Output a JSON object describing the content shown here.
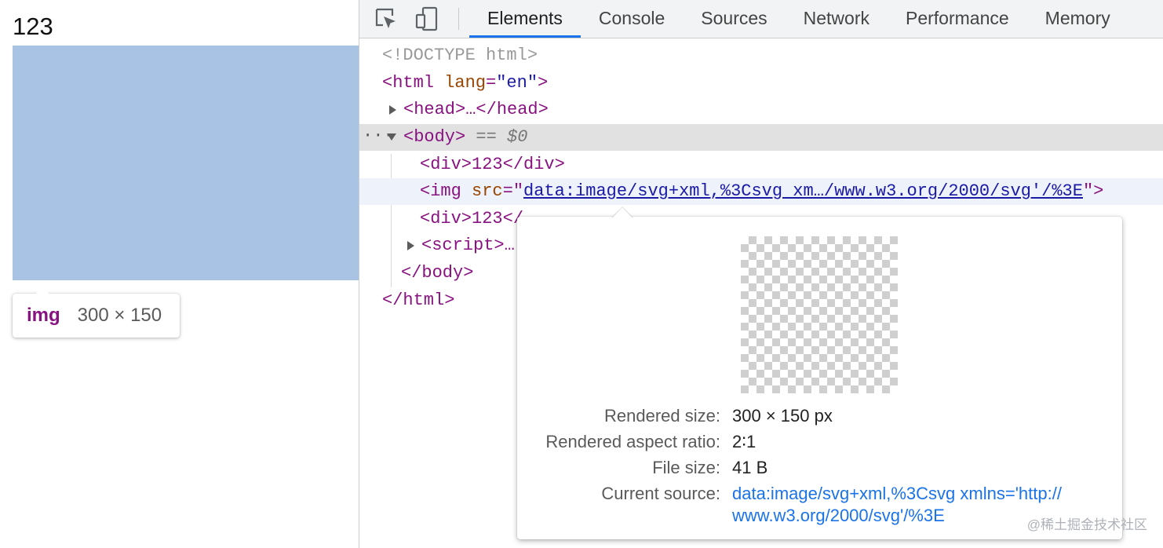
{
  "preview": {
    "page_text": "123",
    "tooltip_tag": "img",
    "tooltip_size": "300 × 150"
  },
  "devtools": {
    "tabs": [
      "Elements",
      "Console",
      "Sources",
      "Network",
      "Performance",
      "Memory"
    ],
    "active_tab": "Elements",
    "dom": {
      "doctype": "<!DOCTYPE html>",
      "html_open_tag": "<html",
      "html_attr_name": "lang",
      "html_attr_value": "\"en\"",
      "head": "<head>…</head>",
      "body_dots": "···",
      "body_tag": "<body>",
      "body_eq": "== $0",
      "div1": "<div>123</div>",
      "img_tag_open": "<img",
      "img_attr_name": "src",
      "img_src": "data:image/svg+xml,%3Csvg xm…/www.w3.org/2000/svg'/%3E",
      "img_tag_close": ">",
      "div2_visible": "<div>123</",
      "script_visible": "<script>…",
      "body_close": "</body>",
      "html_close": "</html>"
    },
    "popover": {
      "rendered_size_label": "Rendered size:",
      "rendered_size_value": "300 × 150 px",
      "aspect_label": "Rendered aspect ratio:",
      "aspect_value": "2∶1",
      "file_size_label": "File size:",
      "file_size_value": "41 B",
      "current_source_label": "Current source:",
      "current_source_line1": "data:image/svg+xml,%3Csvg xmlns='http://",
      "current_source_line2": "www.w3.org/2000/svg'/%3E"
    }
  },
  "watermark": "@稀土掘金技术社区",
  "colors": {
    "tag": "#881280",
    "attr_name": "#994500",
    "attr_value": "#1a1aa6",
    "link": "#1a73e8",
    "highlight": "#a8c3e3",
    "active_tab_underline": "#1a73e8"
  },
  "icons": [
    "inspect-element-icon",
    "device-toolbar-icon"
  ]
}
